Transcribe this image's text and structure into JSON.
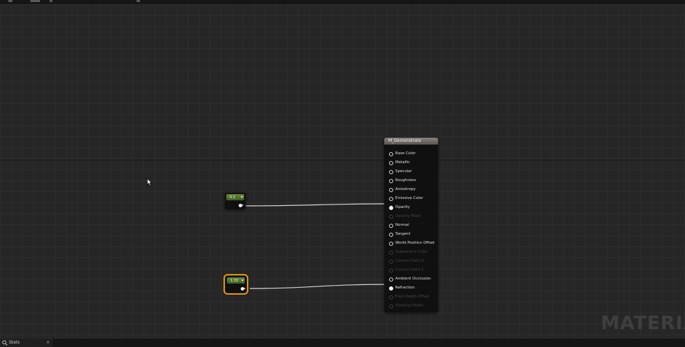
{
  "material_node": {
    "title": "M_Demonstrate",
    "pins": [
      {
        "label": "Base Color",
        "state": "enabled"
      },
      {
        "label": "Metallic",
        "state": "enabled"
      },
      {
        "label": "Specular",
        "state": "enabled"
      },
      {
        "label": "Roughness",
        "state": "enabled"
      },
      {
        "label": "Anisotropy",
        "state": "enabled"
      },
      {
        "label": "Emissive Color",
        "state": "enabled"
      },
      {
        "label": "Opacity",
        "state": "connected"
      },
      {
        "label": "Opacity Mask",
        "state": "disabled"
      },
      {
        "label": "Normal",
        "state": "enabled"
      },
      {
        "label": "Tangent",
        "state": "enabled"
      },
      {
        "label": "World Position Offset",
        "state": "enabled"
      },
      {
        "label": "Subsurface Color",
        "state": "disabled"
      },
      {
        "label": "Custom Data 0",
        "state": "disabled"
      },
      {
        "label": "Custom Data 1",
        "state": "disabled"
      },
      {
        "label": "Ambient Occlusion",
        "state": "enabled"
      },
      {
        "label": "Refraction",
        "state": "connected"
      },
      {
        "label": "Pixel Depth Offset",
        "state": "disabled"
      },
      {
        "label": "Shading Model",
        "state": "disabled"
      }
    ]
  },
  "constant_nodes": [
    {
      "value": "0.1",
      "selected": false,
      "connected_to": "Opacity"
    },
    {
      "value": "1.33",
      "selected": true,
      "connected_to": "Refraction"
    }
  ],
  "watermark": {
    "text": "MATERIAL"
  },
  "status_bar": {
    "tab_label": "Stats",
    "close_glyph": "×"
  },
  "icons": {
    "chevron": "▾",
    "stats": "stats-icon",
    "cursor": "arrow-cursor-icon"
  },
  "colors": {
    "constant_header": "#5a7f30",
    "selection_outline": "#e89a0a",
    "wire": "#d8d8d8",
    "canvas": "#262626"
  }
}
